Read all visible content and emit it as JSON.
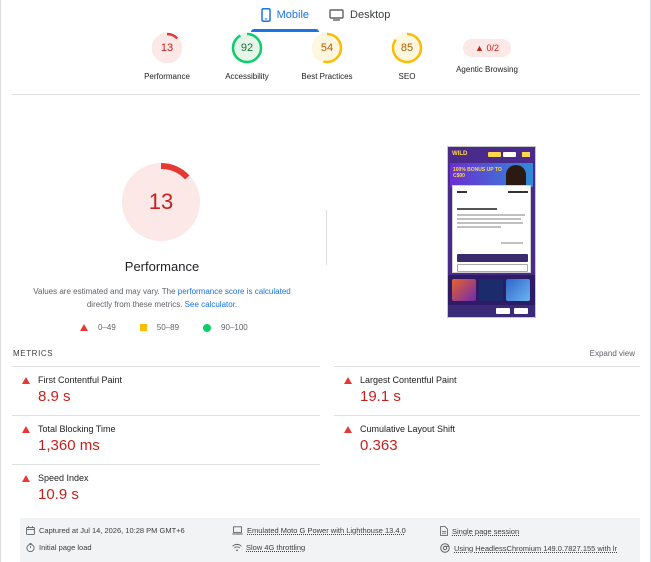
{
  "tabs": [
    {
      "label": "Mobile",
      "icon": "smartphone-icon",
      "active": true
    },
    {
      "label": "Desktop",
      "icon": "monitor-icon",
      "active": false
    }
  ],
  "categories": [
    {
      "score": "13",
      "label": "Performance",
      "color": "#e53935",
      "fraction": 0.13
    },
    {
      "score": "92",
      "label": "Accessibility",
      "color": "#0cce6b",
      "fraction": 0.92
    },
    {
      "score": "54",
      "label": "Best Practices",
      "color": "#fbbc04",
      "fraction": 0.54
    },
    {
      "score": "85",
      "label": "SEO",
      "color": "#fbbc04",
      "fraction": 0.85
    },
    {
      "badge": "▲ 0/2",
      "label": "Agentic Browsing",
      "color": "#c5221f"
    }
  ],
  "hero": {
    "score": "13",
    "fraction": 0.13,
    "color": "#e53935",
    "title": "Performance",
    "desc_prefix": "Values are estimated and may vary. The ",
    "desc_link1": "performance score is calculated",
    "desc_middle": " directly from these metrics. ",
    "desc_link2": "See calculator."
  },
  "legend": [
    {
      "shape": "triangle",
      "range": "0–49",
      "color": "#e53935"
    },
    {
      "shape": "square",
      "range": "50–89",
      "color": "#fbbc04"
    },
    {
      "shape": "circle",
      "range": "90–100",
      "color": "#0cce6b"
    }
  ],
  "thumbnail": {
    "logo": "WILD",
    "hero_text": "100% BONUS UP TO C$00",
    "modal_title": "This website uses cookies",
    "allow_label": "Allow all Cookies",
    "customize_label": "Customize"
  },
  "metrics": {
    "section_title": "METRICS",
    "expand_label": "Expand view",
    "items": [
      {
        "name": "First Contentful Paint",
        "value": "8.9 s",
        "status": "fail"
      },
      {
        "name": "Largest Contentful Paint",
        "value": "19.1 s",
        "status": "fail"
      },
      {
        "name": "Total Blocking Time",
        "value": "1,360 ms",
        "status": "fail"
      },
      {
        "name": "Cumulative Layout Shift",
        "value": "0.363",
        "status": "fail"
      },
      {
        "name": "Speed Index",
        "value": "10.9 s",
        "status": "fail"
      }
    ]
  },
  "info": {
    "captured": "Captured at Jul 14, 2026, 10:28 PM GMT+6",
    "initial_load": "Initial page load",
    "emulated": "Emulated Moto G Power with Lighthouse 13.4.0",
    "throttling": "Slow 4G throttling",
    "session": "Single page session",
    "browser": "Using HeadlessChromium 149.0.7827.155 with lr"
  }
}
